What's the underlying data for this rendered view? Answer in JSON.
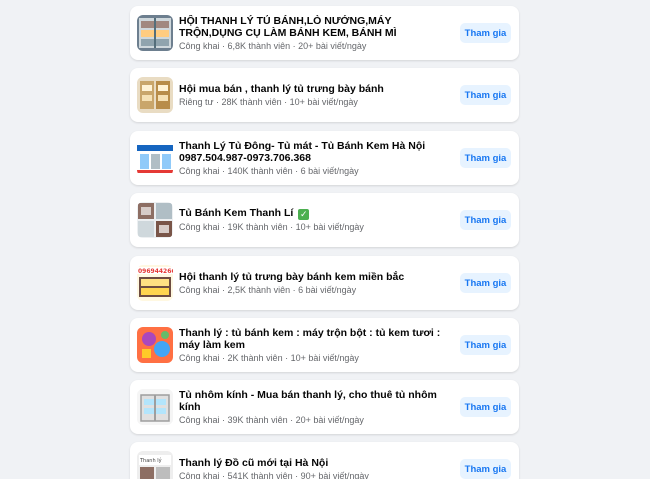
{
  "groups": [
    {
      "name": "HỘI THANH LÝ TỦ BÁNH,LÒ NƯỚNG,MÁY TRỘN,DỤNG CỤ LÀM BÁNH KEM, BÁNH MÌ",
      "privacy": "Công khai",
      "members": "6,8K thành viên",
      "activity": "20+ bài viết/ngày",
      "join_label": "Tham gia",
      "thumb_icon": "bakery-display-case-photo"
    },
    {
      "name": "Hội mua bán , thanh lý tủ trưng bày bánh",
      "privacy": "Riêng tư",
      "members": "28K thành viên",
      "activity": "10+ bài viết/ngày",
      "join_label": "Tham gia",
      "thumb_icon": "display-cabinet-photo"
    },
    {
      "name": "Thanh Lý Tủ Đông- Tủ mát - Tủ Bánh Kem Hà Nội 0987.504.987-0973.706.368",
      "privacy": "Công khai",
      "members": "140K thành viên",
      "activity": "6 bài viết/ngày",
      "join_label": "Tham gia",
      "thumb_icon": "freezer-banner-photo"
    },
    {
      "name": "Tủ Bánh Kem Thanh Lí",
      "name_suffix": "✓",
      "privacy": "Công khai",
      "members": "19K thành viên",
      "activity": "10+ bài viết/ngày",
      "join_label": "Tham gia",
      "thumb_icon": "cake-cabinet-collage-photo"
    },
    {
      "name": "Hội thanh lý tủ trưng bày bánh kem miền bắc",
      "privacy": "Công khai",
      "members": "2,5K thành viên",
      "activity": "6 bài viết/ngày",
      "join_label": "Tham gia",
      "thumb_icon": "red-phone-banner-photo"
    },
    {
      "name": "Thanh lý : tủ bánh kem : máy trộn bột : tủ kem tươi : máy làm kem",
      "privacy": "Công khai",
      "members": "2K thành viên",
      "activity": "10+ bài viết/ngày",
      "join_label": "Tham gia",
      "thumb_icon": "colorful-illustration-photo"
    },
    {
      "name": "Tủ nhôm kính - Mua bán thanh lý, cho thuê tủ nhôm kính",
      "privacy": "Công khai",
      "members": "39K thành viên",
      "activity": "20+ bài viết/ngày",
      "join_label": "Tham gia",
      "thumb_icon": "glass-cabinet-photo"
    },
    {
      "name": "Thanh lý Đồ cũ mới tại Hà Nội",
      "privacy": "Công khai",
      "members": "541K thành viên",
      "activity": "90+ bài viết/ngày",
      "join_label": "Tham gia",
      "thumb_icon": "used-goods-photo"
    }
  ],
  "meta_separator": " · ",
  "colors": {
    "page_bg": "#f0f2f5",
    "card_bg": "#ffffff",
    "join_bg": "#e7f3ff",
    "join_text": "#1877f2",
    "meta_text": "#65676b"
  }
}
